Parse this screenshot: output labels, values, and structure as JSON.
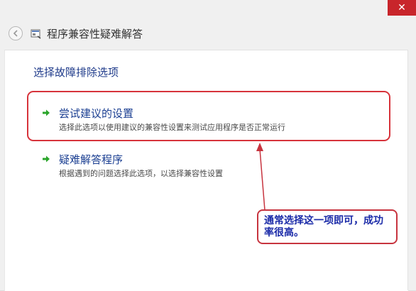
{
  "window": {
    "title": "程序兼容性疑难解答",
    "close_glyph": "✕"
  },
  "content": {
    "heading": "选择故障排除选项",
    "options": [
      {
        "title": "尝试建议的设置",
        "description": "选择此选项以使用建议的兼容性设置来测试应用程序是否正常运行"
      },
      {
        "title": "疑难解答程序",
        "description": "根据遇到的问题选择此选项，以选择兼容性设置"
      }
    ]
  },
  "annotation": {
    "callout_text": "通常选择这一项即可，成功率很高。"
  },
  "icons": {
    "back": "back-arrow-icon",
    "app": "compatibility-app-icon",
    "option_arrow": "green-arrow-icon"
  },
  "colors": {
    "accent_blue": "#1b3f92",
    "annotation_red": "#d7333b",
    "callout_text": "#1a2aa8",
    "arrow_green": "#2aa52a"
  }
}
